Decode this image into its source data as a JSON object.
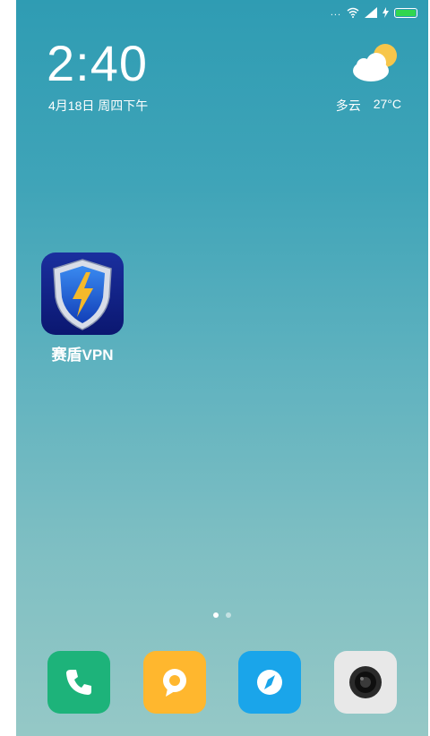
{
  "status": {
    "dots": "...",
    "icons": [
      "wifi-icon",
      "signal-icon",
      "charging-icon",
      "battery-icon"
    ],
    "battery_color": "#31d64f"
  },
  "lockscreen": {
    "time": "2:40",
    "date": "4月18日 周四下午"
  },
  "weather": {
    "condition": "多云",
    "temperature": "27°C",
    "icon": "partly-cloudy-icon"
  },
  "apps": [
    {
      "label": "赛盾VPN",
      "icon": "vpn-shield-icon"
    }
  ],
  "pager": {
    "total": 2,
    "current": 1
  },
  "dock": [
    {
      "icon": "phone-icon",
      "color": "#1db37a"
    },
    {
      "icon": "messages-icon",
      "color": "#ffb72e"
    },
    {
      "icon": "browser-icon",
      "color": "#1aa5ea"
    },
    {
      "icon": "camera-icon",
      "color": "#e8e8e8"
    }
  ]
}
